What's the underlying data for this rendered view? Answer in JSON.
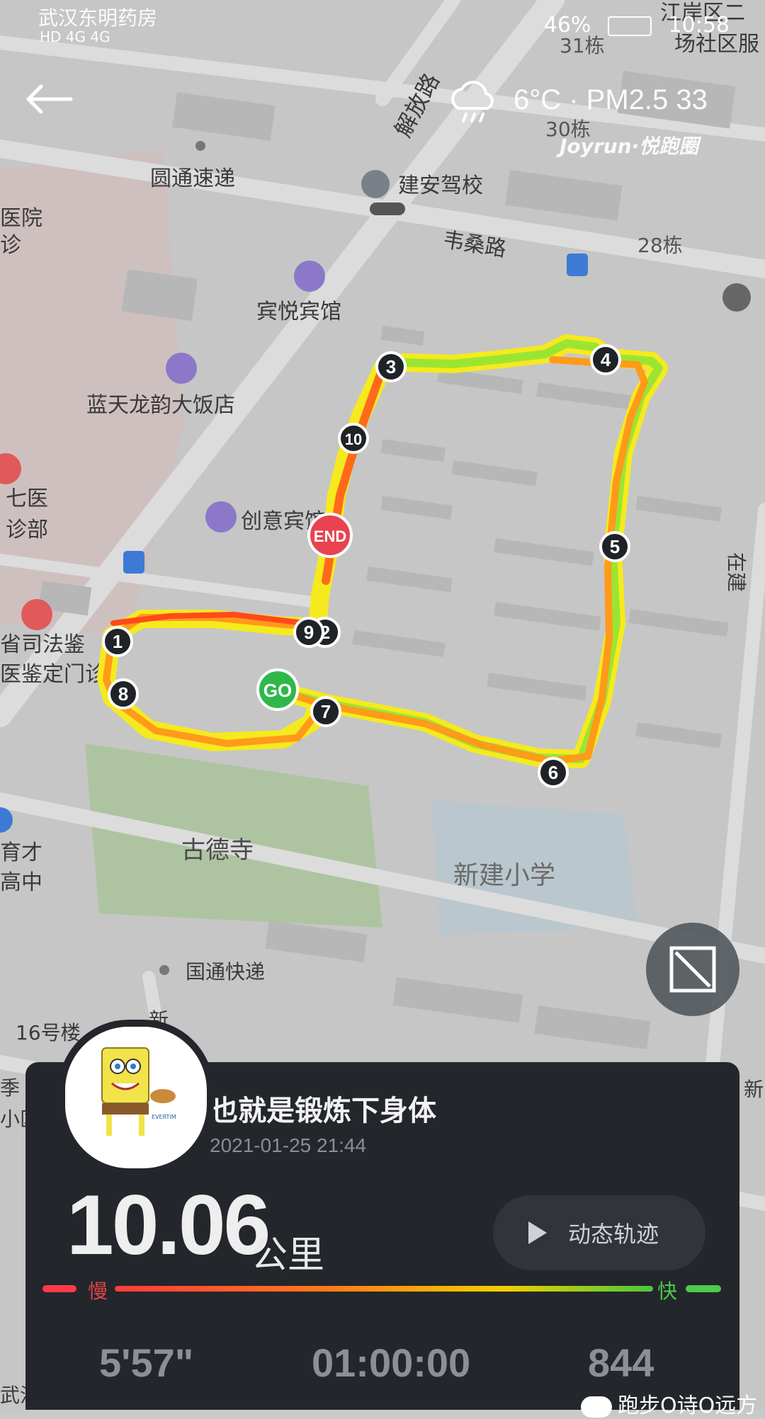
{
  "status_bar": {
    "carrier": "武汉东明药房",
    "network": "HD 4G 4G",
    "battery": "46%",
    "time": "10:58"
  },
  "weather": {
    "text": "6°C · PM2.5 33",
    "brand": "Joyrun·悦跑圈"
  },
  "map": {
    "labels": [
      "江岸区二",
      "场社区服",
      "31栋",
      "30栋",
      "圆通速递",
      "建安驾校",
      "韦桑路",
      "28栋",
      "医院",
      "诊",
      "宾悦宾馆",
      "蓝天龙韵大饭店",
      "七医",
      "诊部",
      "创意宾馆",
      "在建",
      "省司法鉴",
      "医鉴定门诊",
      "古德寺",
      "新建小学",
      "国通快递",
      "16号楼",
      "育才",
      "高中",
      "解放路",
      "新",
      "季",
      "小区",
      "新",
      "武汉"
    ],
    "markers": [
      "1",
      "2",
      "3",
      "4",
      "5",
      "6",
      "7",
      "8",
      "9",
      "10",
      "GO",
      "END"
    ]
  },
  "activity": {
    "title": "也就是锻炼下身体",
    "datetime": "2021-01-25 21:44",
    "distance": "10.06",
    "distance_unit": "公里",
    "replay_label": "动态轨迹",
    "slow_label": "慢",
    "fast_label": "快",
    "pace": "5'57\"",
    "duration": "01:00:00",
    "cadence": "844"
  },
  "watermark": "跑步O诗O远方",
  "colors": {
    "panel_bg": "#23262b",
    "route_slow": "#ff3b3b",
    "route_mid": "#ff9a1a",
    "route_fast": "#48c83d",
    "go_marker": "#2eb84a",
    "end_marker": "#e8434f"
  }
}
